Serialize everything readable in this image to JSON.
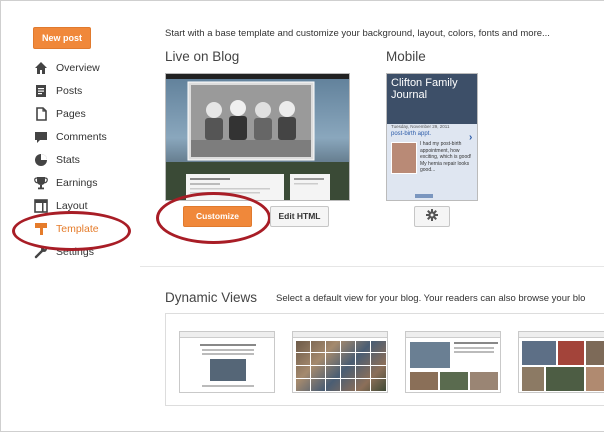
{
  "sidebar": {
    "new_post_label": "New post",
    "items": [
      {
        "label": "Overview",
        "icon": "home-icon"
      },
      {
        "label": "Posts",
        "icon": "posts-icon"
      },
      {
        "label": "Pages",
        "icon": "pages-icon"
      },
      {
        "label": "Comments",
        "icon": "comments-icon"
      },
      {
        "label": "Stats",
        "icon": "stats-icon"
      },
      {
        "label": "Earnings",
        "icon": "trophy-icon"
      },
      {
        "label": "Layout",
        "icon": "layout-icon"
      },
      {
        "label": "Template",
        "icon": "template-icon",
        "active": true
      },
      {
        "label": "Settings",
        "icon": "wrench-icon"
      }
    ]
  },
  "main": {
    "intro": "Start with a base template and customize your background, layout, colors, fonts and more...",
    "live": {
      "heading": "Live on Blog",
      "customize_label": "Customize",
      "edit_html_label": "Edit HTML"
    },
    "mobile": {
      "heading": "Mobile",
      "blog_title": "Clifton Family Journal",
      "date": "Tuesday, November 29, 2011",
      "post_title": "post-birth appt.",
      "post_excerpt": "I had my post-birth appointment, how exciting, which is good! My hernia repair looks good..."
    },
    "dynamic": {
      "heading": "Dynamic Views",
      "description": "Select a default view for your blog. Your readers can also browse your blo"
    }
  },
  "colors": {
    "accent": "#f0883a",
    "active_nav": "#e57c2b",
    "highlight_ring": "#a81d26"
  }
}
